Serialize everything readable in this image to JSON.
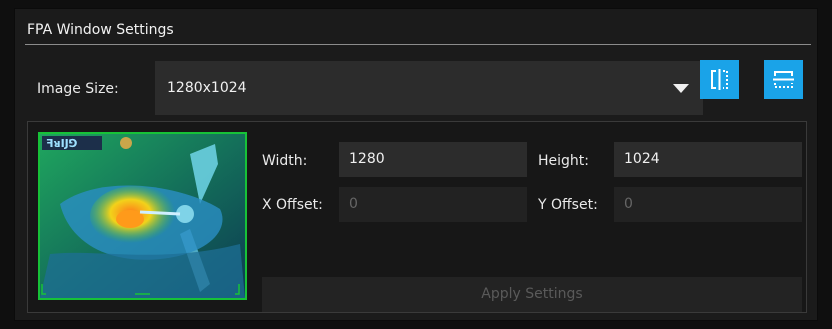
{
  "panel": {
    "title": "FPA Window Settings"
  },
  "image_size": {
    "label": "Image Size:",
    "selected": "1280x1024"
  },
  "icons": {
    "vertical_split": "vertical-split-icon",
    "horizontal_split": "horizontal-split-icon",
    "dropdown": "chevron-down-icon"
  },
  "fields": {
    "width": {
      "label": "Width:",
      "value": "1280"
    },
    "height": {
      "label": "Height:",
      "value": "1024"
    },
    "x_offset": {
      "label": "X Offset:",
      "value": "0"
    },
    "y_offset": {
      "label": "Y Offset:",
      "value": "0"
    }
  },
  "apply_button": {
    "label": "Apply Settings"
  },
  "colors": {
    "accent": "#1aa3e8",
    "thumbnail_border": "#17c238",
    "panel_bg": "#1b1b1b",
    "field_bg": "#2c2c2c"
  }
}
